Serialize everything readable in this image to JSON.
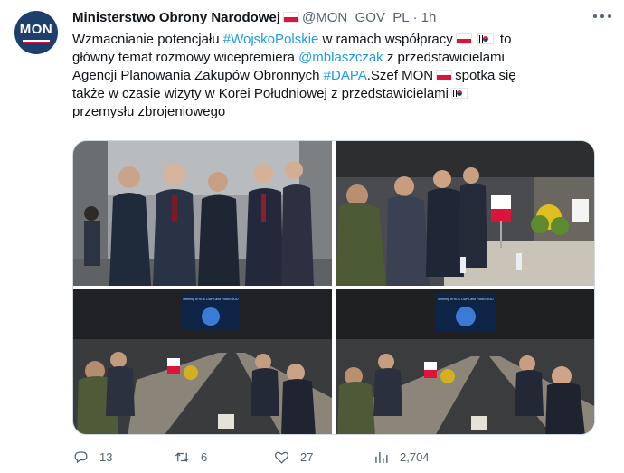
{
  "tweet": {
    "author_name": "Ministerstwo Obrony Narodowej",
    "author_handle": "@MON_GOV_PL",
    "separator": "·",
    "timestamp": "1h",
    "avatar_text": "MON",
    "text_lines": [
      [
        "Wzmacnianie potencjału ",
        "#WojskoPolskie",
        " w ramach współpracy"
      ],
      [
        "główny temat rozmowy wicepremiera ",
        "@mblaszczak",
        " z przedstawicielami"
      ],
      [
        "Agencji Planowania Zakupów Obronnych ",
        "#DAPA",
        ".Szef MON",
        " spotka się"
      ],
      [
        "także w czasie wizyty w Korei Południowej z przedstawicielami"
      ],
      [
        "przemysłu zbrojeniowego"
      ]
    ],
    "text_to": " to",
    "hashtag_1": "#WojskoPolskie",
    "mention": "@mblaszczak",
    "hashtag_2": "#DAPA",
    "line1_a": "Wzmacnianie potencjału ",
    "line1_b": " w ramach współpracy",
    "line2_a": "główny temat rozmowy wicepremiera ",
    "line2_b": " z przedstawicielami",
    "line3_a": "Agencji Planowania Zakupów Obronnych ",
    "line3_b": ".Szef MON",
    "line3_c": "spotka się",
    "line4": "także w czasie wizyty w Korei Południowej z przedstawicielami",
    "line5": "przemysłu zbrojeniowego",
    "screen_text_1": "Meeting of ROK DAPA and Polish MOD",
    "screen_text_2": "Meeting of ROK DAPA and Polish MOD"
  },
  "actions": {
    "replies": "13",
    "retweets": "6",
    "likes": "27",
    "views": "2,704"
  },
  "colors": {
    "link": "#1d9bf0",
    "secondary_text": "#536471",
    "avatar_bg": "#1d3f6e",
    "polish_red": "#dc143c"
  },
  "icons": [
    "more-icon",
    "reply-icon",
    "retweet-icon",
    "like-icon",
    "views-icon",
    "polish-flag-icon",
    "korean-flag-icon"
  ]
}
